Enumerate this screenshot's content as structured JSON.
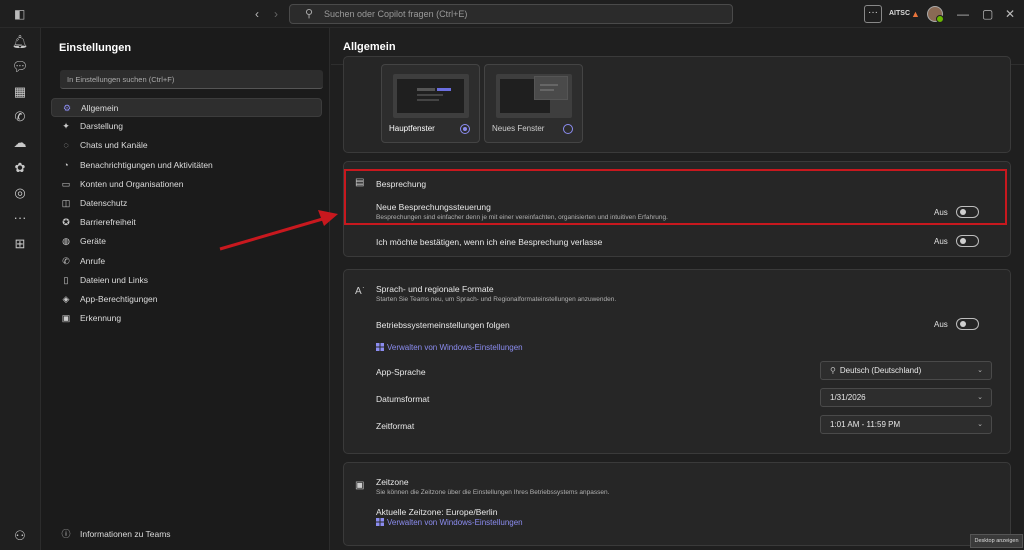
{
  "titlebar": {
    "search_placeholder": "Suchen oder Copilot fragen (Ctrl+E)",
    "more_label": "···",
    "org_label": "AITSC",
    "window_controls": [
      "—",
      "▢",
      "✕"
    ]
  },
  "rail_icons": [
    "bell-icon",
    "chat-icon",
    "calendar-icon",
    "phone-icon",
    "cloud-icon",
    "copilot-icon",
    "loop-icon",
    "more-icon",
    "add-app-icon"
  ],
  "settings": {
    "title": "Einstellungen",
    "search_placeholder": "In Einstellungen suchen (Ctrl+F)",
    "items": [
      {
        "label": "Allgemein",
        "icon": "gear-icon",
        "active": true
      },
      {
        "label": "Darstellung",
        "icon": "wand-icon",
        "active": false
      },
      {
        "label": "Chats und Kanäle",
        "icon": "chat-icon",
        "active": false
      },
      {
        "label": "Benachrichtigungen und Aktivitäten",
        "icon": "bell-icon",
        "active": false
      },
      {
        "label": "Konten und Organisationen",
        "icon": "account-icon",
        "active": false
      },
      {
        "label": "Datenschutz",
        "icon": "lock-icon",
        "active": false
      },
      {
        "label": "Barrierefreiheit",
        "icon": "accessibility-icon",
        "active": false
      },
      {
        "label": "Geräte",
        "icon": "speaker-icon",
        "active": false
      },
      {
        "label": "Anrufe",
        "icon": "phone-icon",
        "active": false
      },
      {
        "label": "Dateien und Links",
        "icon": "file-icon",
        "active": false
      },
      {
        "label": "App-Berechtigungen",
        "icon": "shield-icon",
        "active": false
      },
      {
        "label": "Erkennung",
        "icon": "recognition-icon",
        "active": false
      }
    ],
    "footer": "Informationen zu Teams"
  },
  "main": {
    "title": "Allgemein",
    "window_options": [
      {
        "label": "Hauptfenster",
        "selected": true
      },
      {
        "label": "Neues Fenster",
        "selected": false
      }
    ],
    "meeting": {
      "title": "Besprechung",
      "new_controls_label": "Neue Besprechungssteuerung",
      "new_controls_desc": "Besprechungen sind einfacher denn je mit einer vereinfachten, organisierten und intuitiven Erfahrung.",
      "new_controls_state": "Aus",
      "confirm_leave_label": "Ich möchte bestätigen, wenn ich eine Besprechung verlasse",
      "confirm_leave_state": "Aus"
    },
    "language": {
      "title": "Sprach- und regionale Formate",
      "desc": "Starten Sie Teams neu, um Sprach- und Regionalformateinstellungen anzuwenden.",
      "follow_os_label": "Betriebssystemeinstellungen folgen",
      "follow_os_state": "Aus",
      "manage_link": "Verwalten von Windows-Einstellungen",
      "app_language_label": "App-Sprache",
      "app_language_value": "Deutsch (Deutschland)",
      "date_format_label": "Datumsformat",
      "date_format_value": "1/31/2026",
      "time_format_label": "Zeitformat",
      "time_format_value": "1:01 AM - 11:59 PM"
    },
    "timezone": {
      "title": "Zeitzone",
      "desc": "Sie können die Zeitzone über die Einstellungen Ihres Betriebssystems anpassen.",
      "current_label": "Aktuelle Zeitzone: Europe/Berlin",
      "manage_link": "Verwalten von Windows-Einstellungen"
    }
  },
  "desktop_toast": "Desktop anzeigen",
  "colors": {
    "accent": "#8b8cf0",
    "highlight": "#c8181e",
    "warning": "#e8743b"
  }
}
